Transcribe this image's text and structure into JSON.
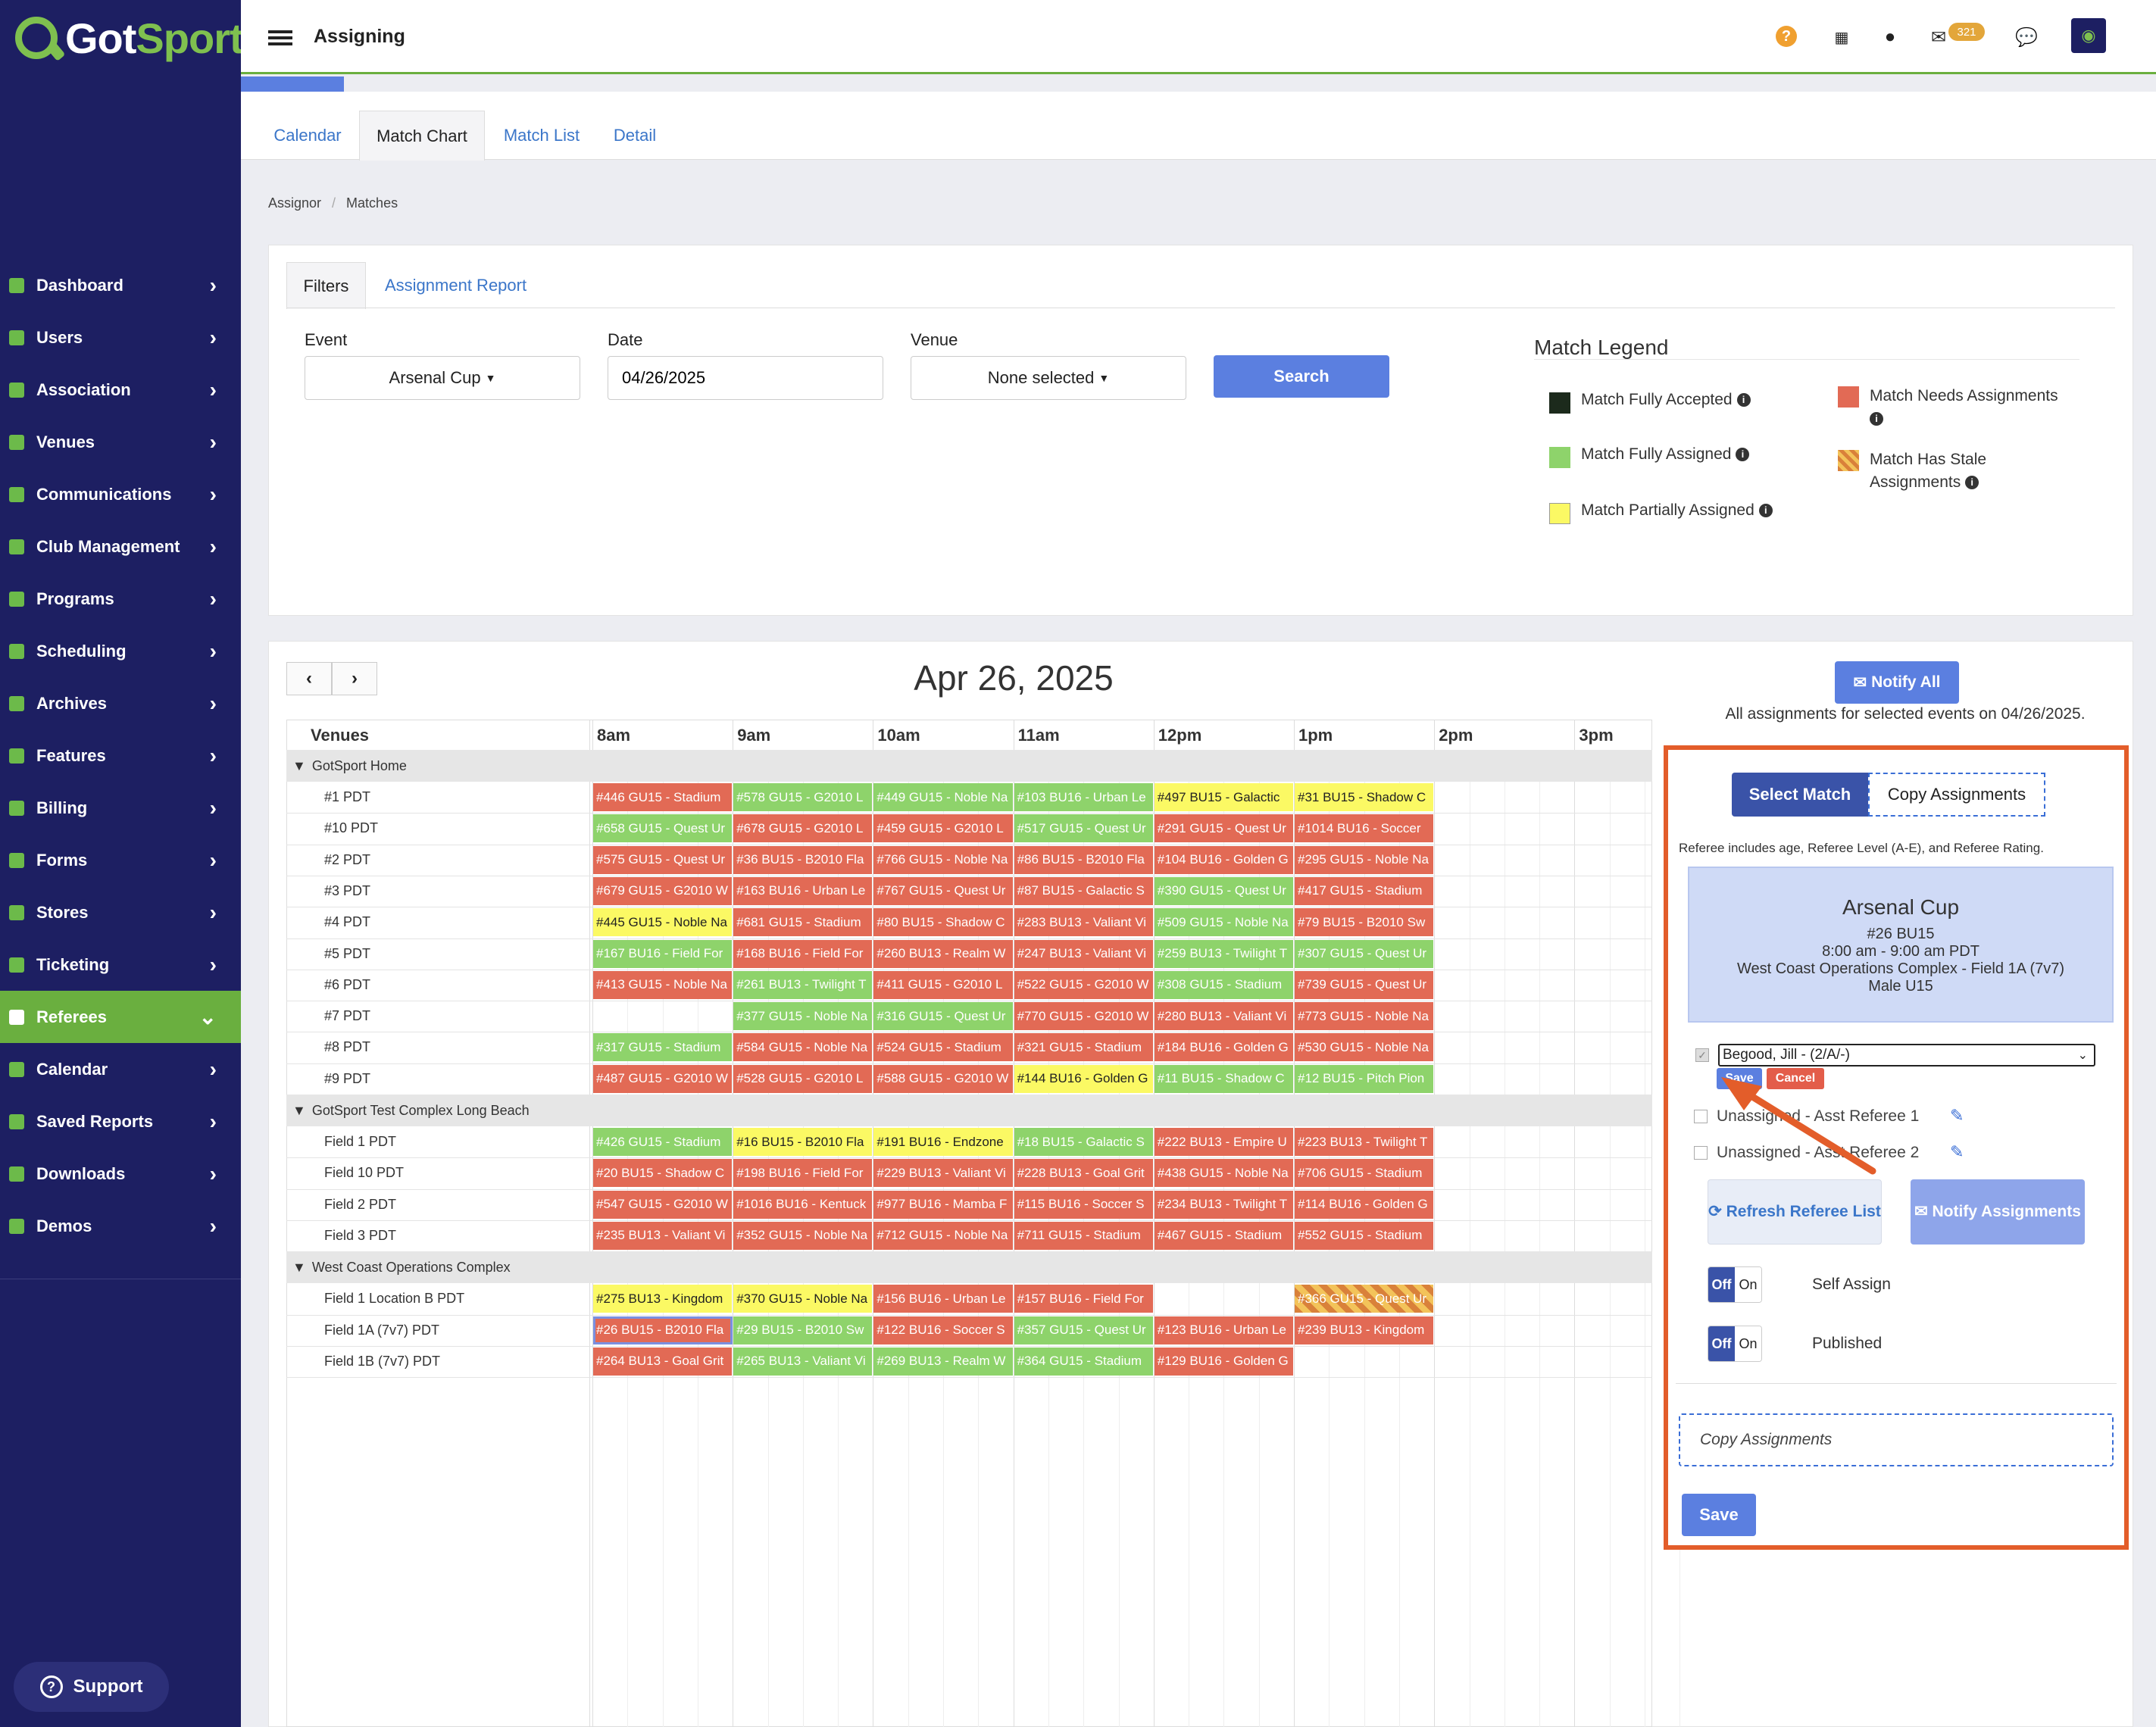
{
  "header": {
    "title": "Assigning",
    "badge": "321"
  },
  "sidebar": {
    "items": [
      {
        "label": "Dashboard"
      },
      {
        "label": "Users"
      },
      {
        "label": "Association"
      },
      {
        "label": "Venues"
      },
      {
        "label": "Communications"
      },
      {
        "label": "Club Management"
      },
      {
        "label": "Programs"
      },
      {
        "label": "Scheduling"
      },
      {
        "label": "Archives"
      },
      {
        "label": "Features"
      },
      {
        "label": "Billing"
      },
      {
        "label": "Forms"
      },
      {
        "label": "Stores"
      },
      {
        "label": "Ticketing"
      },
      {
        "label": "Referees",
        "active": true
      },
      {
        "label": "Calendar"
      },
      {
        "label": "Saved Reports"
      },
      {
        "label": "Downloads"
      },
      {
        "label": "Demos"
      }
    ],
    "support_label": "Support"
  },
  "tabs": [
    "Calendar",
    "Match Chart",
    "Match List",
    "Detail"
  ],
  "breadcrumb": [
    "Assignor",
    "Matches"
  ],
  "filters": {
    "tabs": [
      "Filters",
      "Assignment Report"
    ],
    "event_label": "Event",
    "event_value": "Arsenal Cup",
    "date_label": "Date",
    "date_value": "04/26/2025",
    "venue_label": "Venue",
    "venue_value": "None selected",
    "search_label": "Search"
  },
  "legend": {
    "title": "Match Legend",
    "items": [
      {
        "label": "Match Fully Accepted",
        "color": "#1c2a1c"
      },
      {
        "label": "Match Fully Assigned",
        "color": "#8ed36b"
      },
      {
        "label": "Match Partially Assigned",
        "color": "#fbf964"
      },
      {
        "label": "Match Needs Assignments",
        "color": "#e26a55"
      },
      {
        "label": "Match Has Stale Assignments",
        "color": "#d9813a"
      }
    ]
  },
  "chart": {
    "date_title": "Apr 26, 2025",
    "venues_header": "Venues",
    "hours": [
      "8am",
      "9am",
      "10am",
      "11am",
      "12pm",
      "1pm",
      "2pm",
      "3pm"
    ],
    "groups": [
      {
        "name": "GotSport Home",
        "rows": [
          {
            "name": "#1 PDT",
            "matches": [
              {
                "slot": 0,
                "label": "#446 GU15 - Stadium",
                "status": "red"
              },
              {
                "slot": 1,
                "label": "#578 GU15 - G2010 L",
                "status": "green"
              },
              {
                "slot": 2,
                "label": "#449 GU15 - Noble Na",
                "status": "green"
              },
              {
                "slot": 3,
                "label": "#103 BU16 - Urban Le",
                "status": "green"
              },
              {
                "slot": 4,
                "label": "#497 BU15 - Galactic",
                "status": "yellow"
              },
              {
                "slot": 5,
                "label": "#31 BU15 - Shadow C",
                "status": "yellow"
              }
            ]
          },
          {
            "name": "#10 PDT",
            "matches": [
              {
                "slot": 0,
                "label": "#658 GU15 - Quest Ur",
                "status": "green"
              },
              {
                "slot": 1,
                "label": "#678 GU15 - G2010 L",
                "status": "red"
              },
              {
                "slot": 2,
                "label": "#459 GU15 - G2010 L",
                "status": "red"
              },
              {
                "slot": 3,
                "label": "#517 GU15 - Quest Ur",
                "status": "green"
              },
              {
                "slot": 4,
                "label": "#291 GU15 - Quest Ur",
                "status": "red"
              },
              {
                "slot": 5,
                "label": "#1014 BU16 - Soccer",
                "status": "red"
              }
            ]
          },
          {
            "name": "#2 PDT",
            "matches": [
              {
                "slot": 0,
                "label": "#575 GU15 - Quest Ur",
                "status": "red"
              },
              {
                "slot": 1,
                "label": "#36 BU15 - B2010 Fla",
                "status": "red"
              },
              {
                "slot": 2,
                "label": "#766 GU15 - Noble Na",
                "status": "red"
              },
              {
                "slot": 3,
                "label": "#86 BU15 - B2010 Fla",
                "status": "red"
              },
              {
                "slot": 4,
                "label": "#104 BU16 - Golden G",
                "status": "red"
              },
              {
                "slot": 5,
                "label": "#295 GU15 - Noble Na",
                "status": "red"
              }
            ]
          },
          {
            "name": "#3 PDT",
            "matches": [
              {
                "slot": 0,
                "label": "#679 GU15 - G2010 W",
                "status": "red"
              },
              {
                "slot": 1,
                "label": "#163 BU16 - Urban Le",
                "status": "red"
              },
              {
                "slot": 2,
                "label": "#767 GU15 - Quest Ur",
                "status": "red"
              },
              {
                "slot": 3,
                "label": "#87 BU15 - Galactic S",
                "status": "red"
              },
              {
                "slot": 4,
                "label": "#390 GU15 - Quest Ur",
                "status": "green"
              },
              {
                "slot": 5,
                "label": "#417 GU15 - Stadium",
                "status": "red"
              }
            ]
          },
          {
            "name": "#4 PDT",
            "matches": [
              {
                "slot": 0,
                "label": "#445 GU15 - Noble Na",
                "status": "yellow"
              },
              {
                "slot": 1,
                "label": "#681 GU15 - Stadium",
                "status": "red"
              },
              {
                "slot": 2,
                "label": "#80 BU15 - Shadow C",
                "status": "red"
              },
              {
                "slot": 3,
                "label": "#283 BU13 - Valiant Vi",
                "status": "red"
              },
              {
                "slot": 4,
                "label": "#509 GU15 - Noble Na",
                "status": "green"
              },
              {
                "slot": 5,
                "label": "#79 BU15 - B2010 Sw",
                "status": "red"
              }
            ]
          },
          {
            "name": "#5 PDT",
            "matches": [
              {
                "slot": 0,
                "label": "#167 BU16 - Field For",
                "status": "green"
              },
              {
                "slot": 1,
                "label": "#168 BU16 - Field For",
                "status": "red"
              },
              {
                "slot": 2,
                "label": "#260 BU13 - Realm W",
                "status": "red"
              },
              {
                "slot": 3,
                "label": "#247 BU13 - Valiant Vi",
                "status": "red"
              },
              {
                "slot": 4,
                "label": "#259 BU13 - Twilight T",
                "status": "green"
              },
              {
                "slot": 5,
                "label": "#307 GU15 - Quest Ur",
                "status": "green"
              }
            ]
          },
          {
            "name": "#6 PDT",
            "matches": [
              {
                "slot": 0,
                "label": "#413 GU15 - Noble Na",
                "status": "red"
              },
              {
                "slot": 1,
                "label": "#261 BU13 - Twilight T",
                "status": "green"
              },
              {
                "slot": 2,
                "label": "#411 GU15 - G2010 L",
                "status": "red"
              },
              {
                "slot": 3,
                "label": "#522 GU15 - G2010 W",
                "status": "red"
              },
              {
                "slot": 4,
                "label": "#308 GU15 - Stadium",
                "status": "green"
              },
              {
                "slot": 5,
                "label": "#739 GU15 - Quest Ur",
                "status": "red"
              }
            ]
          },
          {
            "name": "#7 PDT",
            "matches": [
              {
                "slot": 1,
                "label": "#377 GU15 - Noble Na",
                "status": "green"
              },
              {
                "slot": 2,
                "label": "#316 GU15 - Quest Ur",
                "status": "green"
              },
              {
                "slot": 3,
                "label": "#770 GU15 - G2010 W",
                "status": "red"
              },
              {
                "slot": 4,
                "label": "#280 BU13 - Valiant Vi",
                "status": "red"
              },
              {
                "slot": 5,
                "label": "#773 GU15 - Noble Na",
                "status": "red"
              }
            ]
          },
          {
            "name": "#8 PDT",
            "matches": [
              {
                "slot": 0,
                "label": "#317 GU15 - Stadium",
                "status": "green"
              },
              {
                "slot": 1,
                "label": "#584 GU15 - Noble Na",
                "status": "red"
              },
              {
                "slot": 2,
                "label": "#524 GU15 - Stadium",
                "status": "red"
              },
              {
                "slot": 3,
                "label": "#321 GU15 - Stadium",
                "status": "red"
              },
              {
                "slot": 4,
                "label": "#184 BU16 - Golden G",
                "status": "red"
              },
              {
                "slot": 5,
                "label": "#530 GU15 - Noble Na",
                "status": "red"
              }
            ]
          },
          {
            "name": "#9 PDT",
            "matches": [
              {
                "slot": 0,
                "label": "#487 GU15 - G2010 W",
                "status": "red"
              },
              {
                "slot": 1,
                "label": "#528 GU15 - G2010 L",
                "status": "red"
              },
              {
                "slot": 2,
                "label": "#588 GU15 - G2010 W",
                "status": "red"
              },
              {
                "slot": 3,
                "label": "#144 BU16 - Golden G",
                "status": "yellow"
              },
              {
                "slot": 4,
                "label": "#11 BU15 - Shadow C",
                "status": "green"
              },
              {
                "slot": 5,
                "label": "#12 BU15 - Pitch Pion",
                "status": "green"
              }
            ]
          }
        ]
      },
      {
        "name": "GotSport Test Complex Long Beach",
        "rows": [
          {
            "name": "Field 1 PDT",
            "matches": [
              {
                "slot": 0,
                "label": "#426 GU15 - Stadium",
                "status": "green"
              },
              {
                "slot": 1,
                "label": "#16 BU15 - B2010 Fla",
                "status": "yellow"
              },
              {
                "slot": 2,
                "label": "#191 BU16 - Endzone",
                "status": "yellow"
              },
              {
                "slot": 3,
                "label": "#18 BU15 - Galactic S",
                "status": "green"
              },
              {
                "slot": 4,
                "label": "#222 BU13 - Empire U",
                "status": "red"
              },
              {
                "slot": 5,
                "label": "#223 BU13 - Twilight T",
                "status": "red"
              }
            ]
          },
          {
            "name": "Field 10 PDT",
            "matches": [
              {
                "slot": 0,
                "label": "#20 BU15 - Shadow C",
                "status": "red"
              },
              {
                "slot": 1,
                "label": "#198 BU16 - Field For",
                "status": "red"
              },
              {
                "slot": 2,
                "label": "#229 BU13 - Valiant Vi",
                "status": "red"
              },
              {
                "slot": 3,
                "label": "#228 BU13 - Goal Grit",
                "status": "red"
              },
              {
                "slot": 4,
                "label": "#438 GU15 - Noble Na",
                "status": "red"
              },
              {
                "slot": 5,
                "label": "#706 GU15 - Stadium",
                "status": "red"
              }
            ]
          },
          {
            "name": "Field 2 PDT",
            "matches": [
              {
                "slot": 0,
                "label": "#547 GU15 - G2010 W",
                "status": "red"
              },
              {
                "slot": 1,
                "label": "#1016 BU16 - Kentuck",
                "status": "red"
              },
              {
                "slot": 2,
                "label": "#977 BU16 - Mamba F",
                "status": "red"
              },
              {
                "slot": 3,
                "label": "#115 BU16 - Soccer S",
                "status": "red"
              },
              {
                "slot": 4,
                "label": "#234 BU13 - Twilight T",
                "status": "red"
              },
              {
                "slot": 5,
                "label": "#114 BU16 - Golden G",
                "status": "red"
              }
            ]
          },
          {
            "name": "Field 3 PDT",
            "matches": [
              {
                "slot": 0,
                "label": "#235 BU13 - Valiant Vi",
                "status": "red"
              },
              {
                "slot": 1,
                "label": "#352 GU15 - Noble Na",
                "status": "red"
              },
              {
                "slot": 2,
                "label": "#712 GU15 - Noble Na",
                "status": "red"
              },
              {
                "slot": 3,
                "label": "#711 GU15 - Stadium",
                "status": "red"
              },
              {
                "slot": 4,
                "label": "#467 GU15 - Stadium",
                "status": "red"
              },
              {
                "slot": 5,
                "label": "#552 GU15 - Stadium",
                "status": "red"
              }
            ]
          }
        ]
      },
      {
        "name": "West Coast Operations Complex",
        "rows": [
          {
            "name": "Field 1 Location B PDT",
            "matches": [
              {
                "slot": 0,
                "label": "#275 BU13 - Kingdom",
                "status": "yellow"
              },
              {
                "slot": 1,
                "label": "#370 GU15 - Noble Na",
                "status": "yellow"
              },
              {
                "slot": 2,
                "label": "#156 BU16 - Urban Le",
                "status": "red"
              },
              {
                "slot": 3,
                "label": "#157 BU16 - Field For",
                "status": "red"
              },
              {
                "slot": 5,
                "label": "#366 GU15 - Quest Ur",
                "status": "stale"
              }
            ]
          },
          {
            "name": "Field 1A (7v7) PDT",
            "matches": [
              {
                "slot": 0,
                "label": "#26 BU15 - B2010 Fla",
                "status": "red",
                "selected": true
              },
              {
                "slot": 1,
                "label": "#29 BU15 - B2010 Sw",
                "status": "green"
              },
              {
                "slot": 2,
                "label": "#122 BU16 - Soccer S",
                "status": "red"
              },
              {
                "slot": 3,
                "label": "#357 GU15 - Quest Ur",
                "status": "green"
              },
              {
                "slot": 4,
                "label": "#123 BU16 - Urban Le",
                "status": "red"
              },
              {
                "slot": 5,
                "label": "#239 BU13 - Kingdom",
                "status": "red"
              }
            ]
          },
          {
            "name": "Field 1B (7v7) PDT",
            "matches": [
              {
                "slot": 0,
                "label": "#264 BU13 - Goal Grit",
                "status": "red"
              },
              {
                "slot": 1,
                "label": "#265 BU13 - Valiant Vi",
                "status": "green"
              },
              {
                "slot": 2,
                "label": "#269 BU13 - Realm W",
                "status": "green"
              },
              {
                "slot": 3,
                "label": "#364 GU15 - Stadium",
                "status": "green"
              },
              {
                "slot": 4,
                "label": "#129 BU16 - Golden G",
                "status": "red"
              }
            ]
          }
        ]
      }
    ]
  },
  "assign": {
    "notify_all": "Notify All",
    "all_assignments_text": "All assignments for selected events on 04/26/2025.",
    "select_match_tab": "Select Match",
    "copy_assignments_tab": "Copy Assignments",
    "referee_note": "Referee includes age, Referee Level (A-E), and Referee Rating.",
    "match": {
      "event": "Arsenal Cup",
      "number": "#26 BU15",
      "time": "8:00 am - 9:00 am PDT",
      "venue": "West Coast Operations Complex - Field 1A (7v7)",
      "gender_age": "Male U15"
    },
    "referee_select_value": "Begood, Jill - (2/A/-)",
    "mini_save": "Save",
    "mini_cancel": "Cancel",
    "asst1": "Unassigned - Asst Referee 1",
    "asst2": "Unassigned - Asst Referee 2",
    "refresh_label": "Refresh Referee List",
    "notify_label": "Notify Assignments",
    "self_assign_label": "Self Assign",
    "published_label": "Published",
    "toggle_off": "Off",
    "toggle_on": "On",
    "copy_placeholder": "Copy Assignments",
    "save_label": "Save"
  }
}
